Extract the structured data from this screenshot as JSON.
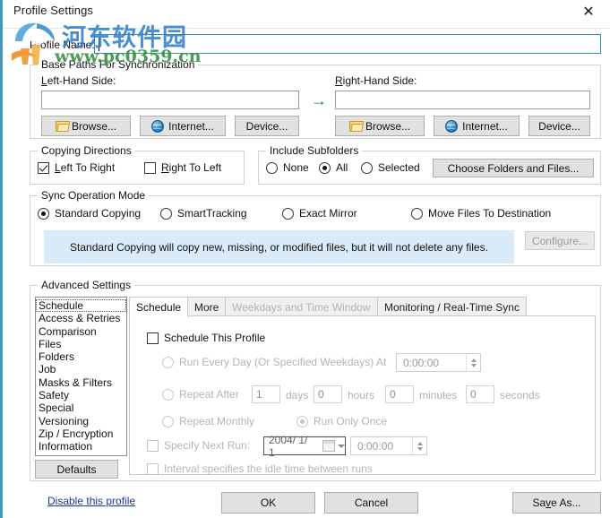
{
  "window": {
    "title": "Profile Settings",
    "close_icon": "close-icon"
  },
  "profile": {
    "label": "Profile Name:",
    "value": "",
    "placeholder": ""
  },
  "base_paths": {
    "legend": "Base Paths For Synchronization",
    "left_label": "Left-Hand Side:",
    "right_label": "Right-Hand Side:",
    "left_value": "",
    "right_value": "",
    "arrow": "→",
    "left_buttons": [
      {
        "label": "Browse...",
        "icon": "folder-icon"
      },
      {
        "label": "Internet...",
        "icon": "globe-icon"
      },
      {
        "label": "Device...",
        "icon": "none"
      }
    ],
    "right_buttons": [
      {
        "label": "Browse...",
        "icon": "folder-icon"
      },
      {
        "label": "Internet...",
        "icon": "globe-icon"
      },
      {
        "label": "Device...",
        "icon": "none"
      }
    ]
  },
  "copying_directions": {
    "legend": "Copying Directions",
    "left_to_right": {
      "label": "Left To Right",
      "checked": true
    },
    "right_to_left": {
      "label": "Right To Left",
      "checked": false
    }
  },
  "include_subfolders": {
    "legend": "Include Subfolders",
    "options": [
      {
        "label": "None",
        "selected": false
      },
      {
        "label": "All",
        "selected": true
      },
      {
        "label": "Selected",
        "selected": false
      }
    ],
    "choose_button": "Choose Folders and Files..."
  },
  "sync_operation_mode": {
    "legend": "Sync Operation Mode",
    "options": [
      {
        "label": "Standard Copying",
        "selected": true
      },
      {
        "label": "SmartTracking",
        "selected": false
      },
      {
        "label": "Exact Mirror",
        "selected": false
      },
      {
        "label": "Move Files To Destination",
        "selected": false
      }
    ],
    "info_text": "Standard Copying will copy new, missing, or modified files, but it will not delete any files.",
    "info_bg": "#d9eaf8",
    "configure_button": {
      "label": "Configure...",
      "enabled": false
    }
  },
  "advanced_settings": {
    "legend": "Advanced Settings",
    "categories": [
      "Schedule",
      "Access & Retries",
      "Comparison",
      "Files",
      "Folders",
      "Job",
      "Masks & Filters",
      "Safety",
      "Special",
      "Versioning",
      "Zip / Encryption",
      "Information"
    ],
    "selected_category": "Schedule",
    "defaults_button": "Defaults",
    "tabs": [
      {
        "label": "Schedule",
        "active": true,
        "enabled": true
      },
      {
        "label": "More",
        "active": false,
        "enabled": true
      },
      {
        "label": "Weekdays and Time Window",
        "active": false,
        "enabled": false
      },
      {
        "label": "Monitoring / Real-Time Sync",
        "active": false,
        "enabled": true
      }
    ],
    "schedule_panel": {
      "schedule_this_profile": {
        "label": "Schedule This Profile",
        "checked": false
      },
      "run_every_day": {
        "label": "Run Every Day (Or Specified Weekdays) At",
        "selected": false,
        "time": "0:00:00"
      },
      "repeat_after": {
        "label": "Repeat After",
        "selected": false,
        "days": "1",
        "days_unit": "days",
        "hours": "0",
        "hours_unit": "hours",
        "minutes": "0",
        "minutes_unit": "minutes",
        "seconds": "0",
        "seconds_unit": "seconds"
      },
      "repeat_monthly": {
        "label": "Repeat Monthly",
        "selected": false
      },
      "run_only_once": {
        "label": "Run Only Once",
        "selected": true
      },
      "specify_next_run": {
        "label": "Specify Next Run:",
        "checked": false,
        "date": "2004/ 1/ 1",
        "time": "0:00:00"
      },
      "interval_idle": {
        "label": "Interval specifies the idle time between runs",
        "checked": false
      }
    }
  },
  "footer": {
    "disable_link": "Disable this profile",
    "ok": "OK",
    "cancel": "Cancel",
    "save_as": "Save As..."
  },
  "watermark": {
    "cn_text": "河东软件园",
    "url_text": "www.pc0359.cn",
    "cn_color": "#2f7fd0",
    "url_color": "#2f8f3c"
  }
}
